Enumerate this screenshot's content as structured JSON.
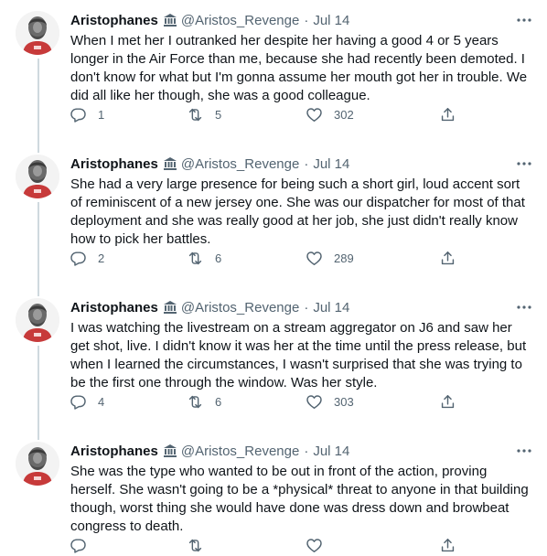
{
  "tweets": [
    {
      "name": "Aristophanes",
      "handle": "@Aristos_Revenge",
      "date": "Jul 14",
      "text": "When I met her I outranked her despite her having a good 4 or 5 years longer in the Air Force than me, because she had recently been demoted. I don't know for what but I'm gonna assume her mouth got her in trouble. We did all like her though, she was a good colleague.",
      "replies": "1",
      "retweets": "5",
      "likes": "302"
    },
    {
      "name": "Aristophanes",
      "handle": "@Aristos_Revenge",
      "date": "Jul 14",
      "text": "She had a very large presence for being such a short girl, loud accent sort of reminiscent of a new jersey one. She was our dispatcher for most of that deployment and she was really good at her job, she just didn't really know how to pick her battles.",
      "replies": "2",
      "retweets": "6",
      "likes": "289"
    },
    {
      "name": "Aristophanes",
      "handle": "@Aristos_Revenge",
      "date": "Jul 14",
      "text": "I was watching the livestream on a stream aggregator on J6 and saw her get shot, live. I didn't know it was her at the time until the press release, but when I learned the circumstances, I wasn't surprised that she was trying to be the first one through the window. Was her style.",
      "replies": "4",
      "retweets": "6",
      "likes": "303"
    },
    {
      "name": "Aristophanes",
      "handle": "@Aristos_Revenge",
      "date": "Jul 14",
      "text": "She was the type who wanted to be out in front of the action, proving herself. She wasn't going to be a *physical* threat to anyone in that building though, worst thing she would have done was dress down and browbeat congress to death.",
      "replies": "",
      "retweets": "",
      "likes": ""
    }
  ],
  "icons": {
    "badge": "classical-building-icon",
    "more": "more-dots-icon",
    "reply": "reply-icon",
    "retweet": "retweet-icon",
    "like": "heart-icon",
    "share": "share-icon"
  },
  "colors": {
    "text": "#0f1419",
    "secondary": "#536471",
    "thread_line": "#cfd9de",
    "divider": "#eff3f4",
    "avatar_shirt": "#c73a3a"
  }
}
